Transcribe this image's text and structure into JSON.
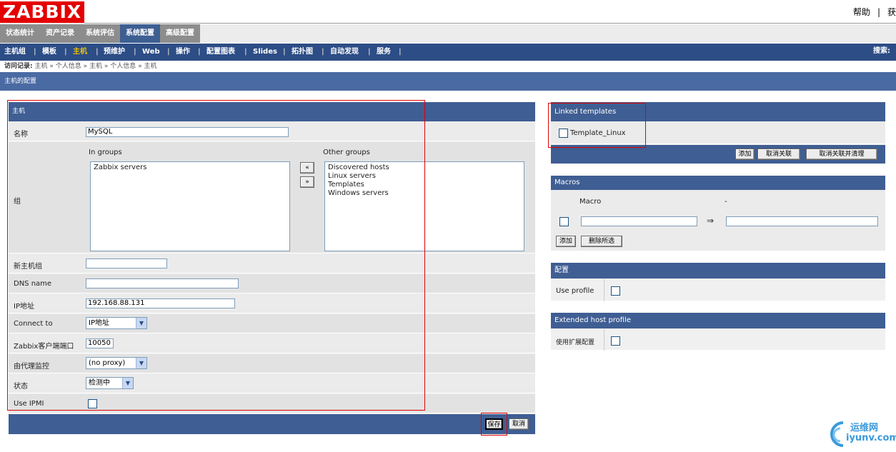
{
  "header": {
    "logo": "ZABBIX",
    "help": "帮助",
    "extra": "获"
  },
  "tabs": [
    "状态统计",
    "资产记录",
    "系统评估",
    "系统配置",
    "高级配置"
  ],
  "subnav": [
    "主机组",
    "模板",
    "主机",
    "预维护",
    "Web",
    "操作",
    "配置图表",
    "Slides",
    "拓扑图",
    "自动发现",
    "服务"
  ],
  "search_label": "搜索:",
  "breadcrumb": {
    "label": "访问记录:",
    "items": [
      "主机",
      "个人信息",
      "主机",
      "个人信息",
      "主机"
    ]
  },
  "page_title": "主机的配置",
  "host": {
    "title": "主机",
    "name_label": "名称",
    "name_value": "MySQL",
    "groups_label": "组",
    "in_groups_label": "In groups",
    "other_groups_label": "Other groups",
    "in_groups": [
      "Zabbix servers"
    ],
    "other_groups": [
      "Discovered hosts",
      "Linux servers",
      "Templates",
      "Windows servers"
    ],
    "move_left": "«",
    "move_right": "»",
    "new_group_label": "新主机组",
    "dns_label": "DNS name",
    "ip_label": "IP地址",
    "ip_value": "192.168.88.131",
    "connect_label": "Connect to",
    "connect_value": "IP地址",
    "port_label": "Zabbix客户端端口",
    "port_value": "10050",
    "proxy_label": "由代理监控",
    "proxy_value": "(no proxy)",
    "status_label": "状态",
    "status_value": "检测中",
    "ipmi_label": "Use IPMI",
    "save": "保存",
    "cancel": "取消"
  },
  "linked": {
    "title": "Linked templates",
    "template": "Template_Linux",
    "add": "添加",
    "unlink": "取消关联",
    "unlink_clear": "取消关联并清理"
  },
  "macros": {
    "title": "Macros",
    "macro_col": "Macro",
    "value_col": "-",
    "arrow": "⇒",
    "add": "添加",
    "remove": "删除所选"
  },
  "profile": {
    "title": "配置",
    "use_label": "Use profile"
  },
  "ext": {
    "title": "Extended host profile",
    "use_label": "使用扩展配置"
  },
  "watermark": {
    "line1": "运维网",
    "line2": "iyunv.com"
  },
  "colors": {
    "logo": "#e40000",
    "nav": "#2d4d86",
    "panel_header": "#3f5e93",
    "active_nav": "#f3c300",
    "highlight": "#e00000"
  }
}
